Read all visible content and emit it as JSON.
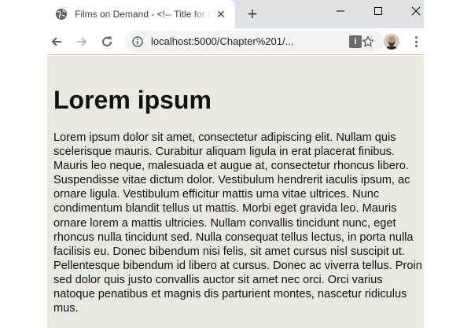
{
  "tab": {
    "title": "Films on Demand - <!-- Title for this page -->",
    "close_label": "✕",
    "new_tab_label": "+"
  },
  "address": {
    "url": "localhost:5000/Chapter%201/..."
  },
  "extension": {
    "label": "i"
  },
  "page": {
    "heading": "Lorem ipsum",
    "paragraph": "Lorem ipsum dolor sit amet, consectetur adipiscing elit. Nullam quis scelerisque mauris. Curabitur aliquam ligula in erat placerat finibus. Mauris leo neque, malesuada et augue at, consectetur rhoncus libero. Suspendisse vitae dictum dolor. Vestibulum hendrerit iaculis ipsum, ac ornare ligula. Vestibulum efficitur mattis urna vitae ultrices. Nunc condimentum blandit tellus ut mattis. Morbi eget gravida leo. Mauris ornare lorem a mattis ultricies. Nullam convallis tincidunt nunc, eget rhoncus nulla tincidunt sed. Nulla consequat tellus lectus, in porta nulla facilisis eu. Donec bibendum nisi felis, sit amet cursus nisl suscipit ut. Pellentesque bibendum id libero at cursus. Donec ac viverra tellus. Proin sed dolor quis justo convallis auctor sit amet nec orci. Orci varius natoque penatibus et magnis dis parturient montes, nascetur ridiculus mus."
  },
  "colors": {
    "page_background": "#ebe8e1",
    "tabstrip": "#dee1e6",
    "omnibox": "#f1f3f4"
  },
  "icons": {
    "favicon": "globe-icon",
    "back": "arrow-left-icon",
    "forward": "arrow-right-icon",
    "reload": "reload-icon",
    "site_info": "info-icon",
    "bookmark": "star-icon",
    "profile": "avatar",
    "menu": "kebab-menu-icon"
  }
}
